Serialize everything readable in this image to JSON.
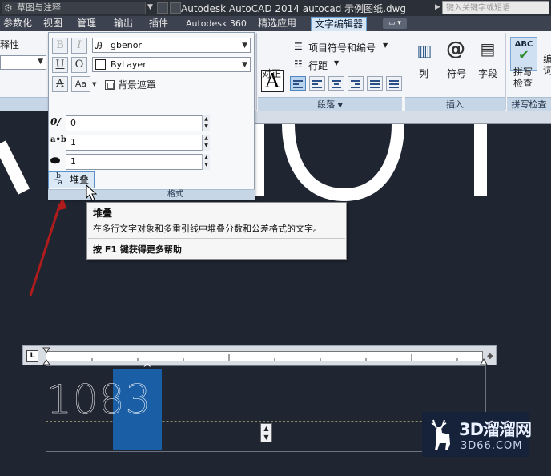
{
  "titlebar": {
    "workspace": "草图与注释",
    "app_title": "Autodesk AutoCAD 2014    autocad 示例图纸.dwg",
    "search_placeholder": "键入关键字或短语"
  },
  "tabs": [
    "参数化",
    "视图",
    "管理",
    "输出",
    "插件",
    "Autodesk 360",
    "精选应用",
    "文字编辑器"
  ],
  "active_tab": "文字编辑器",
  "left_panel": {
    "label": "释性"
  },
  "format_panel": {
    "font": "gbenor",
    "color": "ByLayer",
    "background_mask": "背景遮罩",
    "oblique_value": "0",
    "tracking_value": "1",
    "width_value": "1",
    "stack_label": "堆叠",
    "footer": "格式",
    "buttons": {
      "bold": "B",
      "italic": "I",
      "underline": "U",
      "overline": "Ō",
      "strike": "A",
      "case": "Aa"
    }
  },
  "paragraph_panel": {
    "justify": "对正",
    "bullets": "项目符号和编号",
    "line_spacing": "行距",
    "label": "段落"
  },
  "insert_panel": {
    "column": "列",
    "symbol": "符号",
    "field": "字段",
    "label": "插入"
  },
  "spell_panel": {
    "abc": "ABC",
    "spell_check": "拼写\n检查",
    "edit_dict": "编\n词",
    "label": "拼写检查"
  },
  "tooltip": {
    "title": "堆叠",
    "description": "在多行文字对象和多重引线中堆叠分数和公差格式的文字。",
    "help": "按 F1 键获得更多帮助"
  },
  "editor": {
    "typed_text": "1083",
    "ruler_tab_glyph": "L"
  },
  "watermark": {
    "top": "3D溜溜网",
    "bottom": "3D66.COM"
  }
}
